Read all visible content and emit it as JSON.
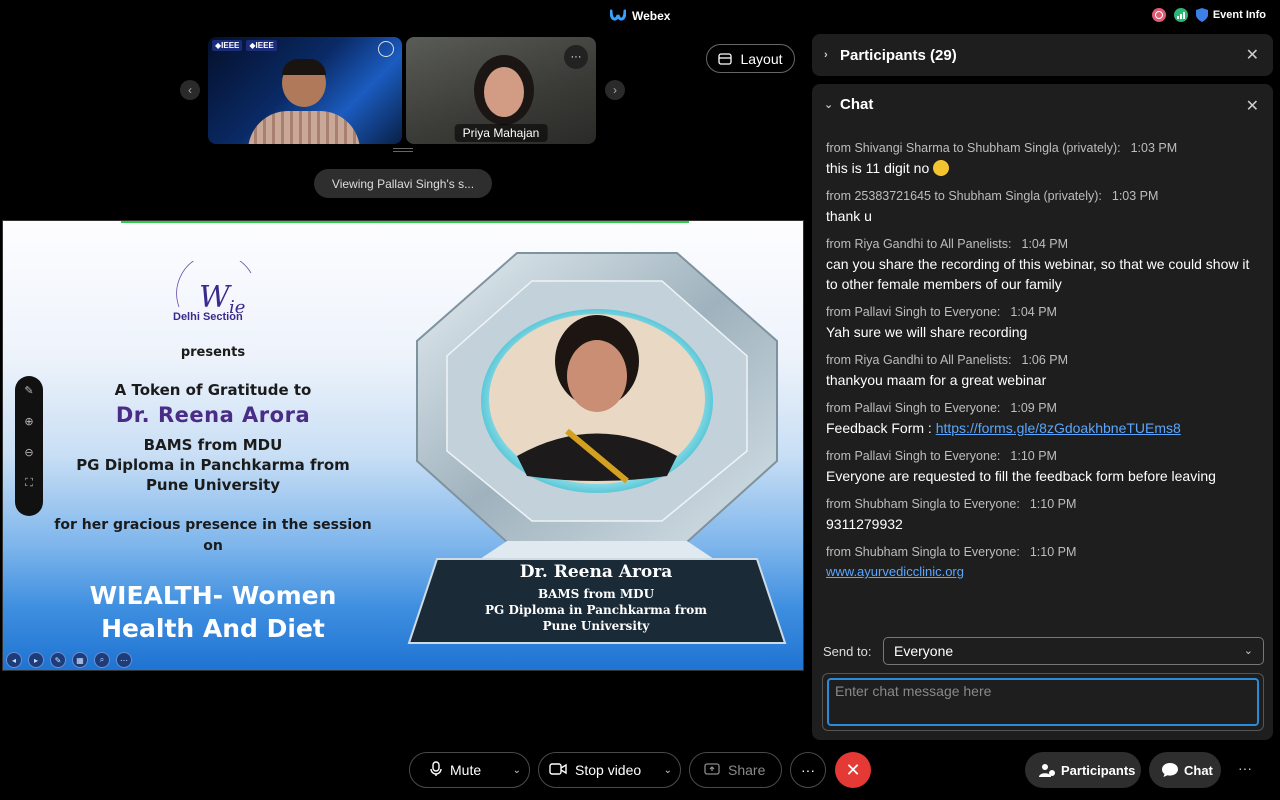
{
  "titlebar": {
    "app_name": "Webex",
    "event_info": "Event Info"
  },
  "videos": {
    "tile1_tags": [
      "◆IEEE",
      "◆IEEE"
    ],
    "tile2_name": "Priya Mahajan",
    "tile_more": "···",
    "layout_label": "Layout",
    "viewing_label": "Viewing Pallavi Singh's s..."
  },
  "slide": {
    "wie_section": "Delhi Section",
    "presents": "presents",
    "gratitude": "A Token of Gratitude to",
    "name": "Dr. Reena Arora",
    "cred1": "BAMS from MDU",
    "cred2": "PG Diploma in Panchkarma from",
    "cred3": "Pune University",
    "gracious1": "for her gracious presence in the session",
    "gracious2": "on",
    "title1": "WIEALTH- Women",
    "title2": "Health And Diet",
    "plaque_name": "Dr. Reena Arora",
    "plaque_cred1": "BAMS from MDU",
    "plaque_cred2": "PG Diploma in Panchkarma from",
    "plaque_cred3": "Pune University"
  },
  "panel": {
    "participants_title": "Participants (29)",
    "chat_title": "Chat",
    "messages": [
      {
        "meta": "from Shivangi Sharma to Shubham Singla (privately):",
        "time": "1:03  PM",
        "text": "this is 11 digit no"
      },
      {
        "meta": "from 25383721645 to Shubham Singla (privately):",
        "time": "1:03  PM",
        "text": "thank u"
      },
      {
        "meta": "from Riya Gandhi to All Panelists:",
        "time": "1:04  PM",
        "text": "can you share the recording of this webinar, so that we could show it to other female members of our family"
      },
      {
        "meta": "from Pallavi Singh to Everyone:",
        "time": "1:04  PM",
        "text": "Yah sure we will share recording"
      },
      {
        "meta": "from Riya Gandhi to All Panelists:",
        "time": "1:06  PM",
        "text": "thankyou maam for a great webinar"
      },
      {
        "meta": "from Pallavi Singh to Everyone:",
        "time": "1:09  PM",
        "text_prefix": "Feedback Form : ",
        "link": "https://forms.gle/8zGdoakhbneTUEms8"
      },
      {
        "meta": "from Pallavi Singh to Everyone:",
        "time": "1:10  PM",
        "text": "Everyone are requested to fill the feedback form before leaving"
      },
      {
        "meta": "from Shubham Singla to Everyone:",
        "time": "1:10  PM",
        "text": "9311279932"
      },
      {
        "meta": "from Shubham Singla to Everyone:",
        "time": "1:10  PM",
        "link": "www.ayurvedicclinic.org"
      }
    ],
    "send_to_label": "Send to:",
    "send_to_value": "Everyone",
    "input_placeholder": "Enter chat message here"
  },
  "controls": {
    "mute": "Mute",
    "stop_video": "Stop video",
    "share": "Share",
    "more": "···",
    "participants": "Participants",
    "chat": "Chat",
    "overflow": "···"
  },
  "colors": {
    "accent_blue": "#2f8ad6",
    "end_red": "#e53935",
    "link": "#5aa6ff"
  }
}
